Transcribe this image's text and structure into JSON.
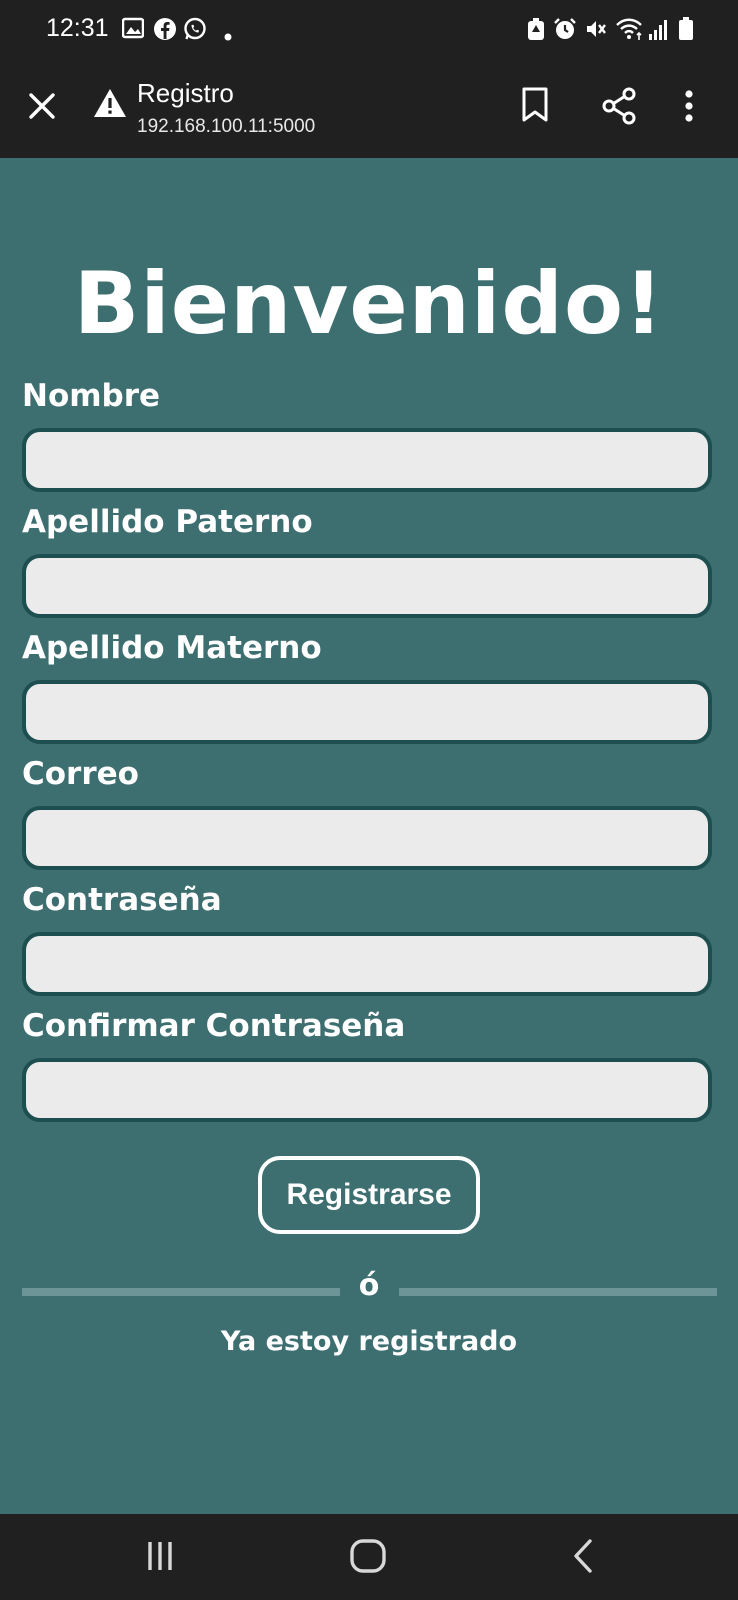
{
  "status_bar": {
    "time": "12:31",
    "left_icons": [
      "image-icon",
      "facebook-icon",
      "whatsapp-icon",
      "dot-icon"
    ],
    "right_icons": [
      "battery-saver-icon",
      "alarm-icon",
      "mute-icon",
      "wifi-icon",
      "signal-icon",
      "battery-icon"
    ]
  },
  "browser": {
    "page_title": "Registro",
    "url": "192.168.100.11:5000",
    "icons": [
      "close-icon",
      "warning-icon",
      "bookmark-icon",
      "share-icon",
      "more-vert-icon"
    ]
  },
  "form": {
    "heading": "Bienvenido!",
    "fields": [
      {
        "label": "Nombre",
        "value": ""
      },
      {
        "label": "Apellido Paterno",
        "value": ""
      },
      {
        "label": "Apellido Materno",
        "value": ""
      },
      {
        "label": "Correo",
        "value": ""
      },
      {
        "label": "Contraseña",
        "value": ""
      },
      {
        "label": "Confirmar Contraseña",
        "value": ""
      }
    ],
    "submit_label": "Registrarse",
    "separator_text": "ó",
    "login_link": "Ya estoy registrado"
  },
  "nav_bar": {
    "icons": [
      "recent-apps-icon",
      "home-icon",
      "back-icon"
    ]
  },
  "colors": {
    "background": "#3d6f71",
    "input_border": "#1e4f50",
    "input_fill": "#ebebeb",
    "system_bars": "#202020"
  }
}
